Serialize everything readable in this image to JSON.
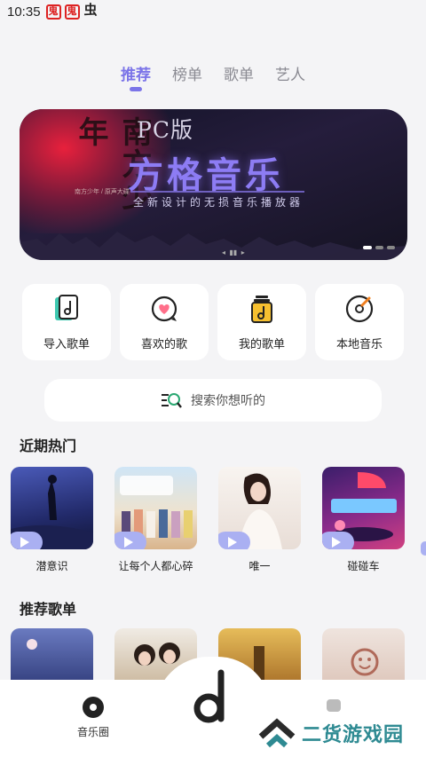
{
  "status_bar": {
    "time": "10:35",
    "icons": [
      "鬼",
      "鬼",
      "虫"
    ]
  },
  "tabs": [
    {
      "label": "推荐",
      "active": true
    },
    {
      "label": "榜单",
      "active": false
    },
    {
      "label": "歌单",
      "active": false
    },
    {
      "label": "艺人",
      "active": false
    }
  ],
  "banner": {
    "callig": "南方少年",
    "small_text": "南方少年 / 原声大碟",
    "pc_label": "PC版",
    "title": "方格音乐",
    "subtitle": "全新设计的无损音乐播放器"
  },
  "quick_actions": [
    {
      "label": "导入歌单",
      "icon": "import-playlist-icon"
    },
    {
      "label": "喜欢的歌",
      "icon": "heart-bubble-icon"
    },
    {
      "label": "我的歌单",
      "icon": "my-playlist-icon"
    },
    {
      "label": "本地音乐",
      "icon": "vinyl-disc-icon"
    }
  ],
  "search": {
    "placeholder": "搜索你想听的"
  },
  "sections": {
    "hot": "近期热门",
    "recommended": "推荐歌单"
  },
  "hot_songs": [
    {
      "title": "潜意识",
      "palette": [
        "#2a3a8a",
        "#1a1e4a"
      ]
    },
    {
      "title": "让每个人都心碎",
      "palette": [
        "#d9e9f7",
        "#e8c9a8"
      ]
    },
    {
      "title": "唯一",
      "palette": [
        "#f3ede8",
        "#d8c8c0"
      ]
    },
    {
      "title": "碰碰车",
      "palette": [
        "#5a2a8a",
        "#c03a78"
      ]
    }
  ],
  "recommended_playlists": [
    {
      "palette": [
        "#3a4a8a",
        "#6a7ac0"
      ]
    },
    {
      "palette": [
        "#e9e2da",
        "#b8a48c"
      ]
    },
    {
      "palette": [
        "#b87a2a",
        "#e8c060"
      ]
    },
    {
      "palette": [
        "#e6d6cf",
        "#d8b8a8"
      ]
    }
  ],
  "bottom_nav": {
    "left_label": "音乐圈",
    "center_icon": "d-logo-icon"
  },
  "watermark": {
    "text": "二货游戏园"
  },
  "colors": {
    "accent": "#7b74e8",
    "play": "#aab0f2",
    "watermark": "#2e8a92"
  }
}
